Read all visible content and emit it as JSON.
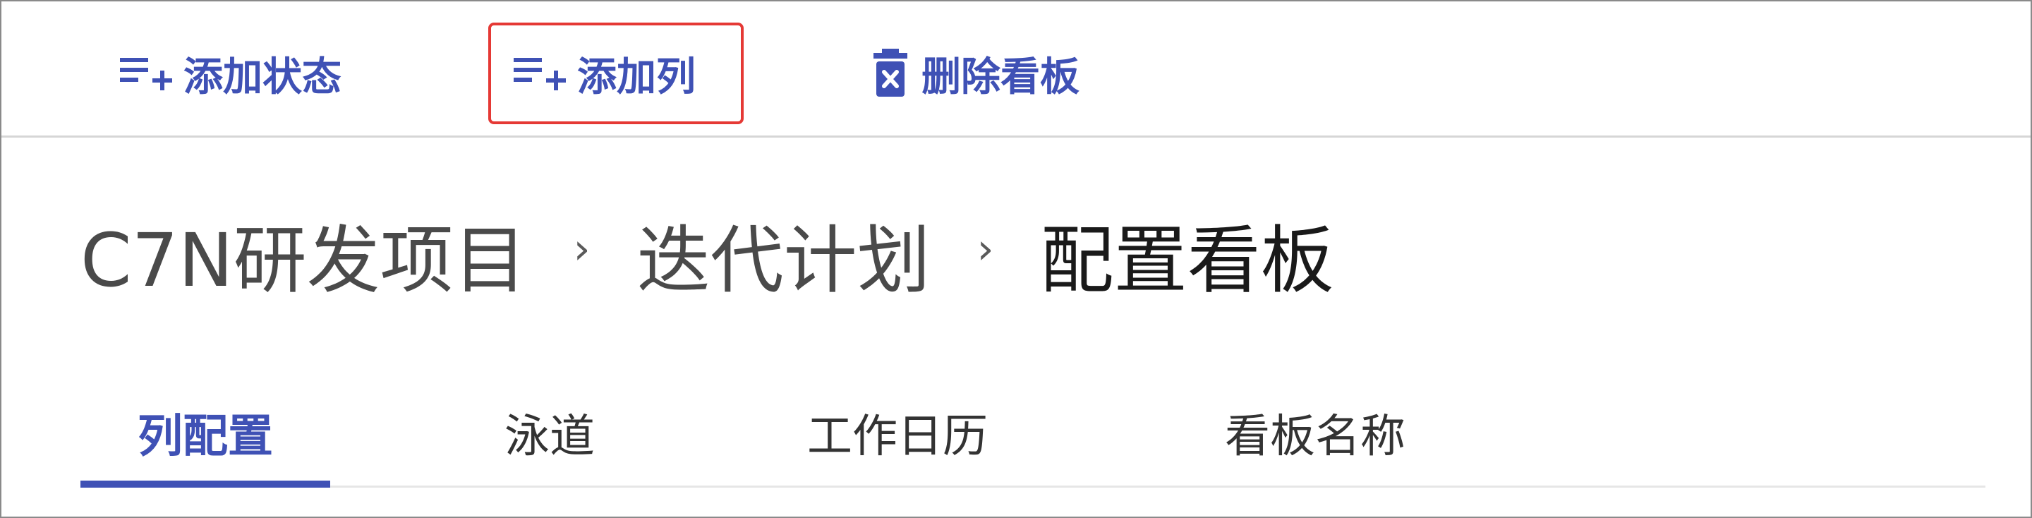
{
  "colors": {
    "accent": "#3f51b5",
    "highlight": "#e53935",
    "text_primary": "#1a1a1a",
    "text_secondary": "#4a4a4a"
  },
  "toolbar": {
    "add_status": {
      "label": "添加状态",
      "icon": "playlist-add-icon"
    },
    "add_column": {
      "label": "添加列",
      "icon": "playlist-add-icon"
    },
    "delete_board": {
      "label": "删除看板",
      "icon": "trash-icon"
    }
  },
  "breadcrumb": {
    "items": [
      "C7N研发项目",
      "迭代计划",
      "配置看板"
    ],
    "separator": "›"
  },
  "tabs": {
    "items": [
      {
        "label": "列配置",
        "active": true
      },
      {
        "label": "泳道",
        "active": false
      },
      {
        "label": "工作日历",
        "active": false
      },
      {
        "label": "看板名称",
        "active": false
      }
    ]
  }
}
